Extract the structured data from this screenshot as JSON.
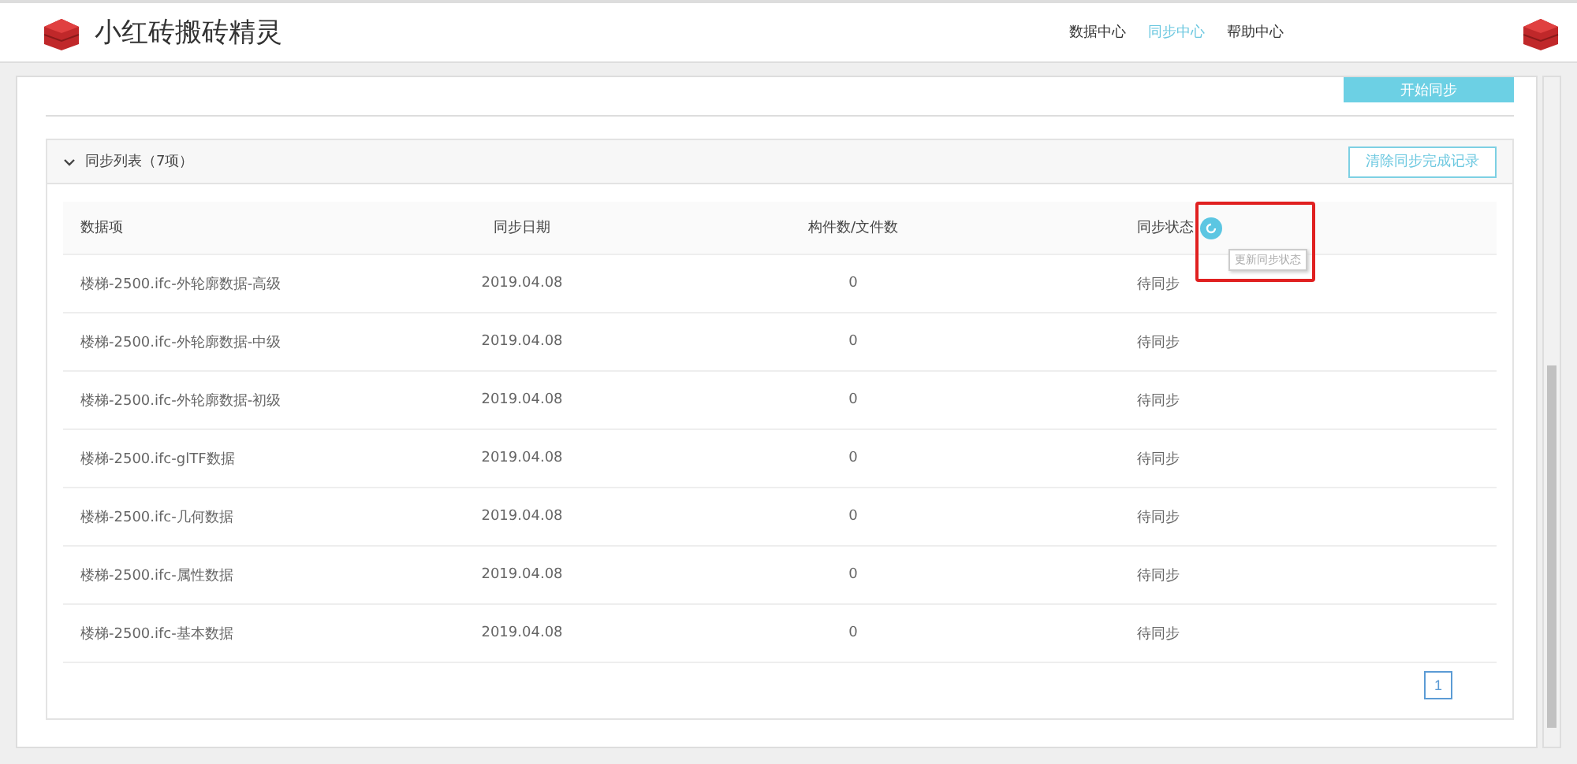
{
  "app": {
    "title": "小红砖搬砖精灵"
  },
  "nav": [
    {
      "label": "数据中心",
      "selected": false
    },
    {
      "label": "同步中心",
      "selected": true
    },
    {
      "label": "帮助中心",
      "selected": false
    }
  ],
  "start_button": "开始同步",
  "section": {
    "title": "同步列表（7项）",
    "expanded": true,
    "clear_button": "清除同步完成记录"
  },
  "table": {
    "columns": [
      "数据项",
      "同步日期",
      "构件数/文件数",
      "同步状态"
    ],
    "refresh_tooltip": "更新同步状态",
    "rows": [
      [
        "楼梯-2500.ifc-外轮廓数据-高级",
        "2019.04.08",
        "0",
        "待同步"
      ],
      [
        "楼梯-2500.ifc-外轮廓数据-中级",
        "2019.04.08",
        "0",
        "待同步"
      ],
      [
        "楼梯-2500.ifc-外轮廓数据-初级",
        "2019.04.08",
        "0",
        "待同步"
      ],
      [
        "楼梯-2500.ifc-glTF数据",
        "2019.04.08",
        "0",
        "待同步"
      ],
      [
        "楼梯-2500.ifc-几何数据",
        "2019.04.08",
        "0",
        "待同步"
      ],
      [
        "楼梯-2500.ifc-属性数据",
        "2019.04.08",
        "0",
        "待同步"
      ],
      [
        "楼梯-2500.ifc-基本数据",
        "2019.04.08",
        "0",
        "待同步"
      ]
    ]
  },
  "pagination": [
    {
      "label": "1",
      "selected": true
    }
  ]
}
